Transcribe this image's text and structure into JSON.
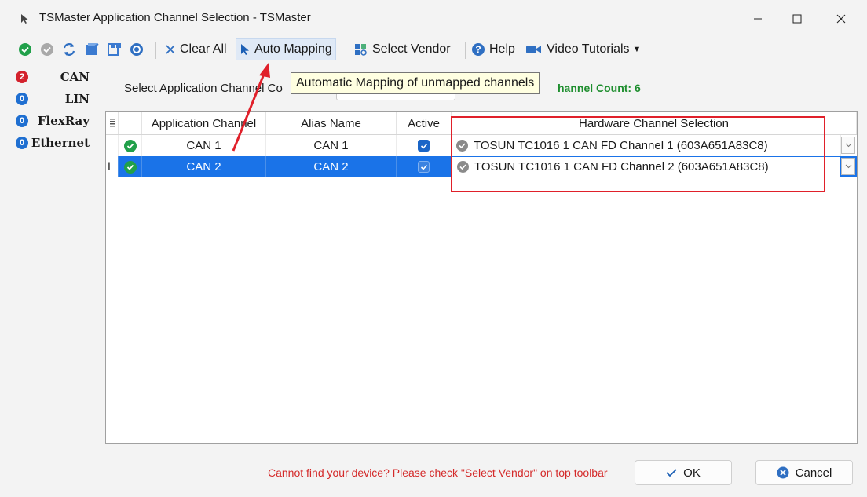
{
  "window": {
    "title": "TSMaster Application Channel Selection - TSMaster"
  },
  "toolbar": {
    "clear_all": "Clear All",
    "auto_mapping": "Auto Mapping",
    "select_vendor": "Select Vendor",
    "help": "Help",
    "video_tutorials": "Video Tutorials"
  },
  "tooltip": {
    "text": "Automatic Mapping of unmapped channels"
  },
  "buses": [
    {
      "name": "CAN",
      "count": "2",
      "badge_color": "#d3212c"
    },
    {
      "name": "LIN",
      "count": "0",
      "badge_color": "#1f6fd1"
    },
    {
      "name": "FlexRay",
      "count": "0",
      "badge_color": "#1f6fd1"
    },
    {
      "name": "Ethernet",
      "count": "0",
      "badge_color": "#1f6fd1"
    }
  ],
  "channel_count": {
    "label": "Select Application Channel Co",
    "hw_count_label": "hannel Count: 6"
  },
  "table": {
    "headers": {
      "application_channel": "Application Channel",
      "alias_name": "Alias Name",
      "active": "Active",
      "hardware_channel": "Hardware Channel Selection"
    },
    "rows": [
      {
        "application_channel": "CAN 1",
        "alias_name": "CAN 1",
        "active": true,
        "hardware_channel": "TOSUN TC1016 1 CAN FD Channel 1 (603A651A83C8)",
        "selected": false
      },
      {
        "application_channel": "CAN 2",
        "alias_name": "CAN 2",
        "active": true,
        "hardware_channel": "TOSUN TC1016 1 CAN FD Channel 2 (603A651A83C8)",
        "selected": true
      }
    ]
  },
  "footer": {
    "note": "Cannot find your device? Please check \"Select Vendor\" on top toolbar",
    "ok": "OK",
    "cancel": "Cancel"
  },
  "colors": {
    "selection": "#1a73e8",
    "status_ok": "#21a04a",
    "highlight_box": "#e0202a",
    "warning_text": "#d42a2a",
    "hw_count_text": "#1e8e2e",
    "tooltip_bg": "#ffffe1"
  }
}
